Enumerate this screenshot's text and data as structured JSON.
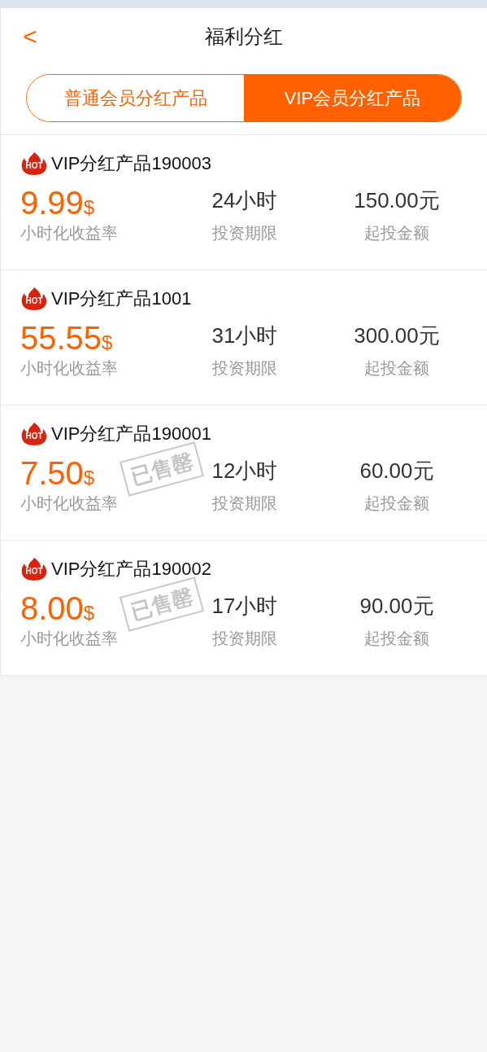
{
  "header": {
    "back": "<",
    "title": "福利分红"
  },
  "tabs": [
    {
      "label": "普通会员分红产品",
      "selected": false
    },
    {
      "label": "VIP会员分红产品",
      "selected": true
    }
  ],
  "products": [
    {
      "badge": "HOT",
      "name": "VIP分红产品190003",
      "rate": "9.99",
      "unit": "$",
      "rate_label": "小时化收益率",
      "term": "24小时",
      "term_label": "投资期限",
      "amount": "150.00元",
      "amount_label": "起投金额"
    },
    {
      "badge": "HOT",
      "name": "VIP分红产品1001",
      "rate": "55.55",
      "unit": "$",
      "rate_label": "小时化收益率",
      "term": "31小时",
      "term_label": "投资期限",
      "amount": "300.00元",
      "amount_label": "起投金额"
    },
    {
      "badge": "HOT",
      "name": "VIP分红产品190001",
      "rate": "7.50",
      "unit": "$",
      "rate_label": "小时化收益率",
      "term": "12小时",
      "term_label": "投资期限",
      "amount": "60.00元",
      "amount_label": "起投金额",
      "stamp": "已售罄"
    },
    {
      "badge": "HOT",
      "name": "VIP分红产品190002",
      "rate": "8.00",
      "unit": "$",
      "rate_label": "小时化收益率",
      "term": "17小时",
      "term_label": "投资期限",
      "amount": "90.00元",
      "amount_label": "起投金额",
      "stamp": "已售罄"
    }
  ]
}
